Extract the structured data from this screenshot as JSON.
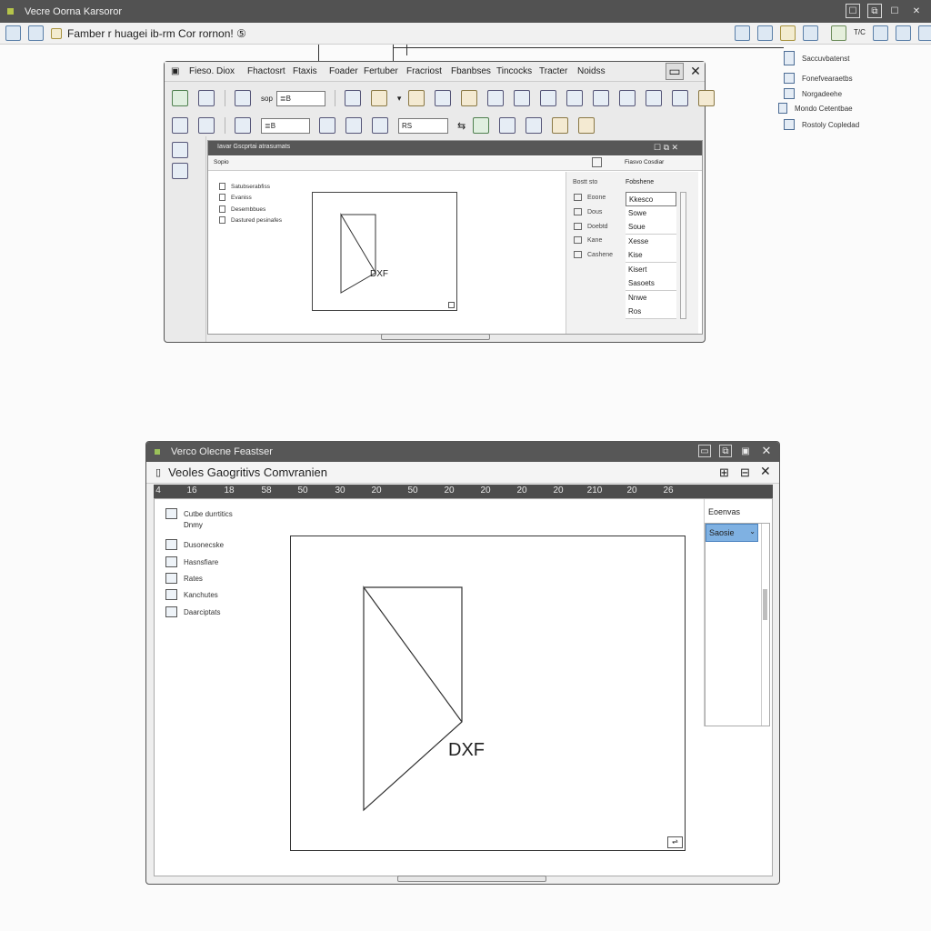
{
  "app": {
    "title": "Vecre Oorna Karsoror",
    "toolbar_text": "Famber r huagei ib-rm Cor rornon! ⑤",
    "controls": [
      "☐",
      "⧉",
      "☐",
      "✕"
    ],
    "right_label": "T/C"
  },
  "right_stack": [
    "Saccuvbatenst",
    "Fonefvearaetbs",
    "Norgadeehe",
    "Mondo Cetentbae",
    "Rostoly Copledad"
  ],
  "win1": {
    "menu": [
      "Fieso. Diox",
      "Fhactosrt",
      "Ftaxis",
      "Foader",
      "Fertuber",
      "Fracriost",
      "Fbanbses",
      "Tincocks",
      "Tracter",
      "Noidss"
    ],
    "field1": "≣B",
    "field2": "≣B",
    "field3": "RS",
    "field_label": "sop",
    "inner_title": "Iavar Gscprtai atrasumats",
    "inner_tab": "Sopio",
    "props_header": "Fiasvo Cosdiar",
    "tree": [
      "Satubserabfiss",
      "Evaniss",
      "Desembbues",
      "Dastured pesinafes"
    ],
    "labels_header": "Bostt sto",
    "labels": [
      "Eoone",
      "Dous",
      "Doebtd",
      "Kane",
      "Cashene"
    ],
    "values_header": "Fobshene",
    "values": [
      "Kkesco",
      "Sowe",
      "Soue",
      "Xesse",
      "Kise",
      "Kisert",
      "Sasoets",
      "Nnwe",
      "Ros"
    ],
    "canvas_label": "DXF"
  },
  "win2": {
    "title": "Verco Olecne Feastser",
    "subtitle": "Veoles  Gaogritivs Comvranien",
    "ruler": [
      "4",
      "16",
      "18",
      "58",
      "50",
      "30",
      "20",
      "50",
      "20",
      "20",
      "20",
      "20",
      "210",
      "20",
      "26"
    ],
    "tree": [
      "Cutbe durrtitics",
      "Dnmy",
      "Dusonecske",
      "Hasnsfiare",
      "Rates",
      "Kanchutes",
      "Daarciptats"
    ],
    "props_label": "Eoenvas",
    "props_selected": "Saosie",
    "canvas_label": "DXF"
  }
}
